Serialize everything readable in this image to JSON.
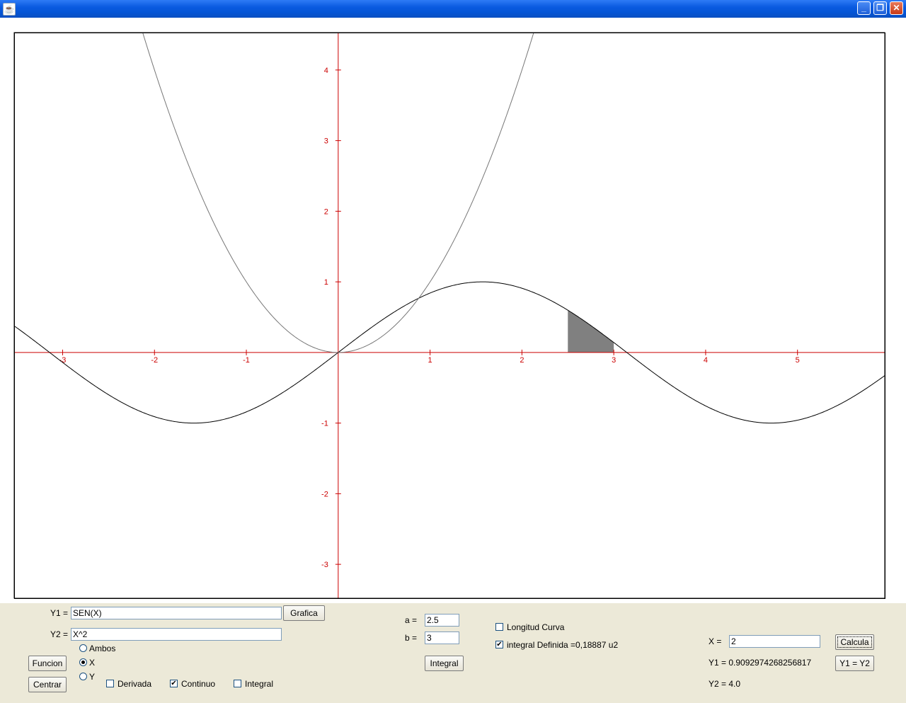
{
  "window": {
    "icon": "java-cup-icon",
    "controls": [
      "minimize-icon",
      "restore-icon",
      "close-icon"
    ],
    "control_glyphs": [
      "_",
      "❐",
      "✕"
    ]
  },
  "chart_data": {
    "type": "line",
    "xlim": [
      -3.52,
      5.95
    ],
    "ylim": [
      -3.48,
      4.52
    ],
    "x_ticks": [
      -3,
      -2,
      -1,
      1,
      2,
      3,
      4,
      5
    ],
    "y_ticks": [
      -3,
      -2,
      -1,
      1,
      2,
      3,
      4
    ],
    "axis_color": "#CC0000",
    "series": [
      {
        "expr": "SEN(X)",
        "color": "#000000"
      },
      {
        "expr": "X^2",
        "color": "#777777"
      }
    ],
    "shaded_integral": {
      "a": 2.5,
      "b": 3,
      "color": "#808080"
    }
  },
  "controls": {
    "y1_label": "Y1 =",
    "y1_value": "SEN(X)",
    "y2_label": "Y2 =",
    "y2_value": "X^2",
    "grafica": "Grafica",
    "funcion": "Funcion",
    "centrar": "Centrar",
    "radios": [
      {
        "label": "Ambos",
        "checked": false
      },
      {
        "label": "X",
        "checked": true
      },
      {
        "label": "Y",
        "checked": false
      }
    ],
    "derivada": {
      "label": "Derivada",
      "checked": false
    },
    "continuo": {
      "label": "Continuo",
      "checked": true
    },
    "integral_chk": {
      "label": "Integral",
      "checked": false
    },
    "a_label": "a =",
    "a_value": "2.5",
    "b_label": "b =",
    "b_value": "3",
    "integral_btn": "Integral",
    "longitud": {
      "label": "Longitud Curva",
      "checked": false
    },
    "integral_def": {
      "label": "integral Definida =0,18887 u2",
      "checked": true
    },
    "x_label": "X =",
    "x_value": "2",
    "calcula": "Calcula",
    "y1y2": "Y1 = Y2",
    "y1_result": "Y1 = 0.9092974268256817",
    "y2_result": "Y2 = 4.0"
  }
}
